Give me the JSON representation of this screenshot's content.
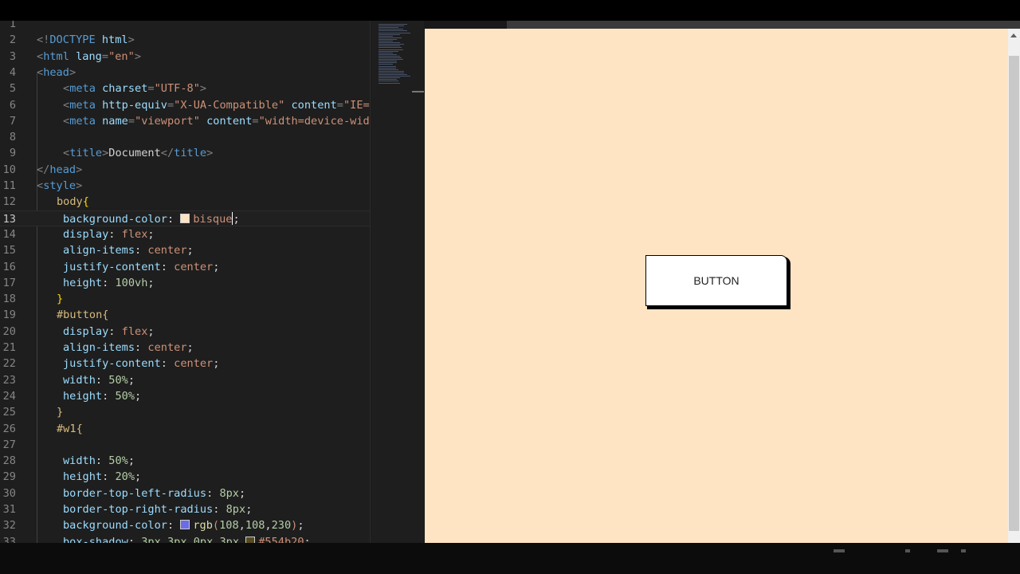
{
  "editor": {
    "lines": [
      {
        "n": "1"
      },
      {
        "n": "2"
      },
      {
        "n": "3"
      },
      {
        "n": "4"
      },
      {
        "n": "5"
      },
      {
        "n": "6"
      },
      {
        "n": "7"
      },
      {
        "n": "8"
      },
      {
        "n": "9"
      },
      {
        "n": "10"
      },
      {
        "n": "11"
      },
      {
        "n": "12"
      },
      {
        "n": "13"
      },
      {
        "n": "14"
      },
      {
        "n": "15"
      },
      {
        "n": "16"
      },
      {
        "n": "17"
      },
      {
        "n": "18"
      },
      {
        "n": "19"
      },
      {
        "n": "20"
      },
      {
        "n": "21"
      },
      {
        "n": "22"
      },
      {
        "n": "23"
      },
      {
        "n": "24"
      },
      {
        "n": "25"
      },
      {
        "n": "26"
      },
      {
        "n": "27"
      },
      {
        "n": "28"
      },
      {
        "n": "29"
      },
      {
        "n": "30"
      },
      {
        "n": "31"
      },
      {
        "n": "32"
      },
      {
        "n": "33"
      }
    ],
    "active_line": "13",
    "tokens": {
      "l2": [
        "<!",
        "DOCTYPE",
        " ",
        "html",
        ">"
      ],
      "l3": [
        "<",
        "html",
        " ",
        "lang",
        "=",
        "\"en\"",
        ">"
      ],
      "l4": [
        "<",
        "head",
        ">"
      ],
      "l5": [
        "<",
        "meta",
        " ",
        "charset",
        "=",
        "\"UTF-8\"",
        ">"
      ],
      "l6": [
        "<",
        "meta",
        " ",
        "http-equiv",
        "=",
        "\"X-UA-Compatible\"",
        " ",
        "content",
        "=",
        "\"IE=e"
      ],
      "l7": [
        "<",
        "meta",
        " ",
        "name",
        "=",
        "\"viewport\"",
        " ",
        "content",
        "=",
        "\"width=device-wid"
      ],
      "l9": [
        "<",
        "title",
        ">",
        "Document",
        "</",
        "title",
        ">"
      ],
      "l10": [
        "</",
        "head",
        ">"
      ],
      "l11": [
        "<",
        "style",
        ">"
      ],
      "l12": [
        "body",
        "{"
      ],
      "l13": [
        "background-color",
        ": ",
        "bisque",
        ";"
      ],
      "l14": [
        "display",
        ": ",
        "flex",
        ";"
      ],
      "l15": [
        "align-items",
        ": ",
        "center",
        ";"
      ],
      "l16": [
        "justify-content",
        ": ",
        "center",
        ";"
      ],
      "l17": [
        "height",
        ": ",
        "100vh",
        ";"
      ],
      "l18": [
        "}"
      ],
      "l19": [
        "#button",
        "{"
      ],
      "l20": [
        "display",
        ": ",
        "flex",
        ";"
      ],
      "l21": [
        "align-items",
        ": ",
        "center",
        ";"
      ],
      "l22": [
        "justify-content",
        ": ",
        "center",
        ";"
      ],
      "l23": [
        "width",
        ": ",
        "50%",
        ";"
      ],
      "l24": [
        "height",
        ": ",
        "50%",
        ";"
      ],
      "l25": [
        "}"
      ],
      "l26": [
        "#w1",
        "{"
      ],
      "l28": [
        "width",
        ": ",
        "50%",
        ";"
      ],
      "l29": [
        "height",
        ": ",
        "20%",
        ";"
      ],
      "l30": [
        "border-top-left-radius",
        ": ",
        "8px",
        ";"
      ],
      "l31": [
        "border-top-right-radius",
        ": ",
        "8px",
        ";"
      ],
      "l32": [
        "background-color",
        ": ",
        "rgb",
        "(",
        "108",
        ",",
        "108",
        ",",
        "230",
        ")",
        ";"
      ],
      "l33": [
        "box-shadow",
        ": ",
        "3px",
        " ",
        "3px",
        " ",
        "0px",
        " ",
        "3px",
        " ",
        "#554b20",
        ";"
      ]
    },
    "swatches": {
      "bisque": "#ffe4c4",
      "rgb_108_108_230": "#6c6ce6",
      "hex_554b20": "#554b20"
    }
  },
  "preview": {
    "background": "#ffe4c4",
    "button_label": "BUTTON"
  }
}
